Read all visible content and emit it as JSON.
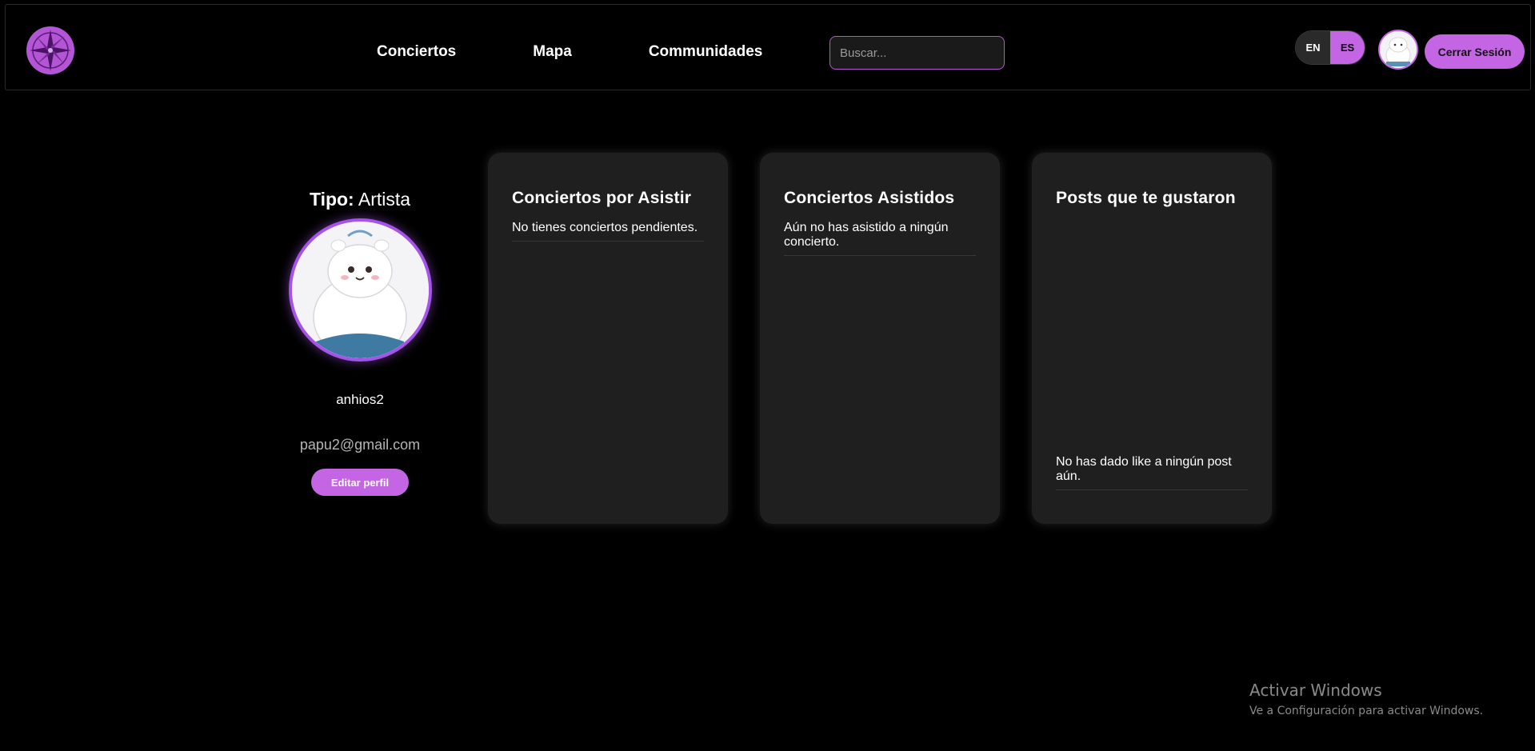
{
  "nav": {
    "links": [
      "Conciertos",
      "Mapa",
      "Communidades"
    ],
    "search_placeholder": "Buscar...",
    "lang": {
      "en": "EN",
      "es": "ES",
      "active": "ES"
    },
    "logout_label": "Cerrar Sesión",
    "logo_icon": "compass-rose-icon"
  },
  "profile": {
    "tipo_label": "Tipo:",
    "tipo_value": "Artista",
    "username": "anhios2",
    "email": "papu2@gmail.com",
    "edit_label": "Editar perfil"
  },
  "cards": [
    {
      "title": "Conciertos por Asistir",
      "message": "No tienes conciertos pendientes."
    },
    {
      "title": "Conciertos Asistidos",
      "message": "Aún no has asistido a ningún concierto."
    },
    {
      "title": "Posts que te gustaron",
      "message": "No has dado like a ningún post aún."
    }
  ],
  "watermark": {
    "title": "Activar Windows",
    "subtitle": "Ve a Configuración para activar Windows."
  },
  "colors": {
    "accent": "#c466e3",
    "avatar_ring": "#a553e8",
    "background": "#000000",
    "card": "#1f1f1f"
  }
}
